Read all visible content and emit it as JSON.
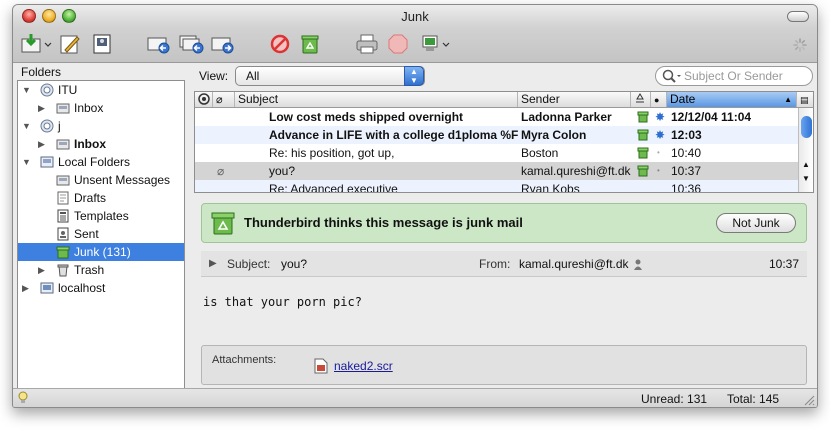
{
  "window": {
    "title": "Junk"
  },
  "toolbar": {
    "icons": [
      "get-mail-icon",
      "compose-icon",
      "address-book-icon",
      "reply-icon",
      "reply-all-icon",
      "forward-icon",
      "junk-icon",
      "delete-icon",
      "print-icon",
      "stop-icon",
      "progress-icon"
    ]
  },
  "folders": {
    "header": "Folders",
    "items": [
      {
        "label": "ITU",
        "indent": 0,
        "tri": "▼"
      },
      {
        "label": "Inbox",
        "indent": 1,
        "tri": "▶"
      },
      {
        "label": "j",
        "indent": 0,
        "tri": "▼"
      },
      {
        "label": "Inbox",
        "indent": 1,
        "tri": "▶",
        "bold": true
      },
      {
        "label": "Local Folders",
        "indent": 0,
        "tri": "▼"
      },
      {
        "label": "Unsent Messages",
        "indent": 1,
        "tri": ""
      },
      {
        "label": "Drafts",
        "indent": 1,
        "tri": ""
      },
      {
        "label": "Templates",
        "indent": 1,
        "tri": ""
      },
      {
        "label": "Sent",
        "indent": 1,
        "tri": ""
      },
      {
        "label": "Junk (131)",
        "indent": 1,
        "tri": "",
        "selected": true
      },
      {
        "label": "Trash",
        "indent": 1,
        "tri": "▶"
      },
      {
        "label": "localhost",
        "indent": 0,
        "tri": "▶"
      }
    ]
  },
  "view": {
    "label": "View:",
    "selected": "All"
  },
  "search": {
    "placeholder": "Subject Or Sender"
  },
  "columns": {
    "subject": "Subject",
    "sender": "Sender",
    "date": "Date"
  },
  "messages": [
    {
      "subject": "Low cost meds shipped overnight",
      "sender": "Ladonna Parker",
      "date": "12/12/04 11:04",
      "unread": true
    },
    {
      "subject": "Advance in LIFE with a college d1ploma %F",
      "sender": "Myra Colon",
      "date": "12:03",
      "unread": true
    },
    {
      "subject": "Re: his position, got up,",
      "sender": "Boston",
      "date": "10:40",
      "unread": false
    },
    {
      "subject": "you?",
      "sender": "kamal.qureshi@ft.dk",
      "date": "10:37",
      "unread": false,
      "selected": true,
      "attachment": true
    },
    {
      "subject": "Re: Advanced executive",
      "sender": "Ryan Kobs",
      "date": "10:36",
      "unread": false
    }
  ],
  "junkbar": {
    "text": "Thunderbird thinks this message is junk mail",
    "button": "Not Junk"
  },
  "message": {
    "subject_label": "Subject:",
    "subject": "you?",
    "from_label": "From:",
    "from": "kamal.qureshi@ft.dk",
    "time": "10:37",
    "body": "is that your porn pic?"
  },
  "attachments": {
    "label": "Attachments:",
    "file": "naked2.scr"
  },
  "status": {
    "unread": "Unread: 131",
    "total": "Total: 145"
  }
}
